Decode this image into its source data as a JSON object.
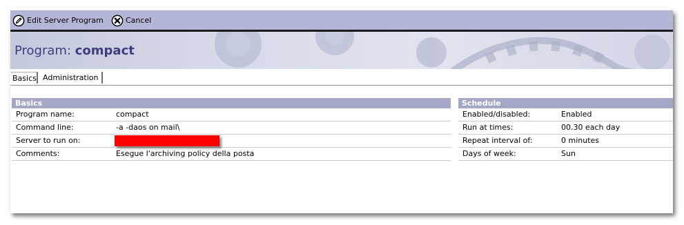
{
  "toolbar": {
    "edit_label": "Edit Server Program",
    "cancel_label": "Cancel"
  },
  "header": {
    "title_prefix": "Program:",
    "title_value": "compact"
  },
  "tabs": [
    {
      "label": "Basics",
      "active": true
    },
    {
      "label": "Administration",
      "active": false
    }
  ],
  "basics": {
    "header": "Basics",
    "rows": [
      {
        "label": "Program name:",
        "value": "compact"
      },
      {
        "label": "Command line:",
        "value": "-a -daos on mail\\"
      },
      {
        "label": "Server to run on:",
        "value": "",
        "redacted": true
      },
      {
        "label": "Comments:",
        "value": "Esegue l'archiving policy della posta"
      }
    ]
  },
  "schedule": {
    "header": "Schedule",
    "rows": [
      {
        "label": "Enabled/disabled:",
        "value": "Enabled"
      },
      {
        "label": "Run at times:",
        "value": "00.30 each day"
      },
      {
        "label": "Repeat interval of:",
        "value": "0 minutes"
      },
      {
        "label": "Days of week:",
        "value": "Sun"
      }
    ]
  },
  "colors": {
    "toolbar_bg": "#b4b6d7",
    "title_text": "#3d3f7e",
    "section_header_bg": "#a4a7c6",
    "redaction": "#ff0000"
  },
  "icons": {
    "edit": "pencil-circle-icon",
    "cancel": "x-circle-icon"
  }
}
